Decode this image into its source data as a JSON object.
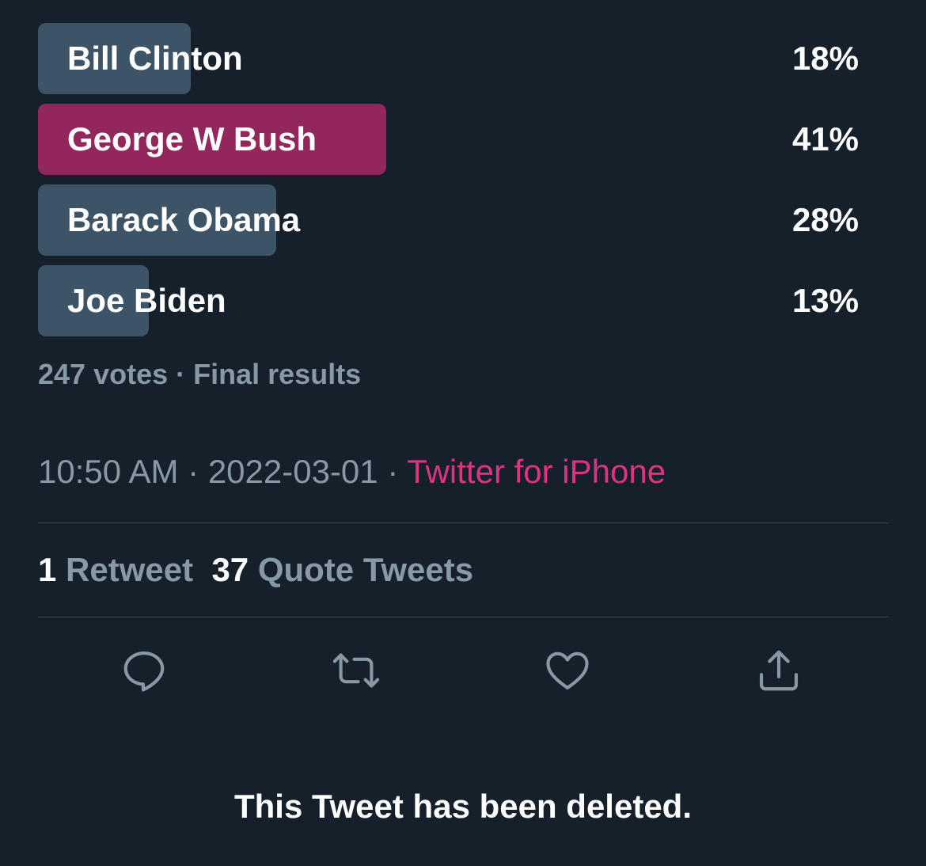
{
  "poll": {
    "options": [
      {
        "label": "Bill Clinton",
        "percent_text": "18%",
        "bar_fraction": 0.18,
        "leader": false
      },
      {
        "label": "George W Bush",
        "percent_text": "41%",
        "bar_fraction": 0.41,
        "leader": true
      },
      {
        "label": "Barack Obama",
        "percent_text": "28%",
        "bar_fraction": 0.28,
        "leader": false
      },
      {
        "label": "Joe Biden",
        "percent_text": "13%",
        "bar_fraction": 0.13,
        "leader": false
      }
    ],
    "votes_text": "247 votes",
    "separator": "·",
    "status_text": "Final results"
  },
  "meta": {
    "time": "10:50 AM",
    "date": "2022-03-01",
    "source": "Twitter for iPhone",
    "separator": "·"
  },
  "stats": {
    "retweet_count": "1",
    "retweet_label": "Retweet",
    "quote_count": "37",
    "quote_label": "Quote Tweets"
  },
  "actions": [
    {
      "icon": "reply-icon"
    },
    {
      "icon": "retweet-icon"
    },
    {
      "icon": "like-icon"
    },
    {
      "icon": "share-icon"
    }
  ],
  "notice": {
    "text": "This Tweet has been deleted."
  },
  "colors": {
    "background": "#15202b",
    "bar": "#3d5466",
    "leader_bar": "#91275c",
    "muted_text": "#8899a6",
    "accent": "#e0337f"
  }
}
